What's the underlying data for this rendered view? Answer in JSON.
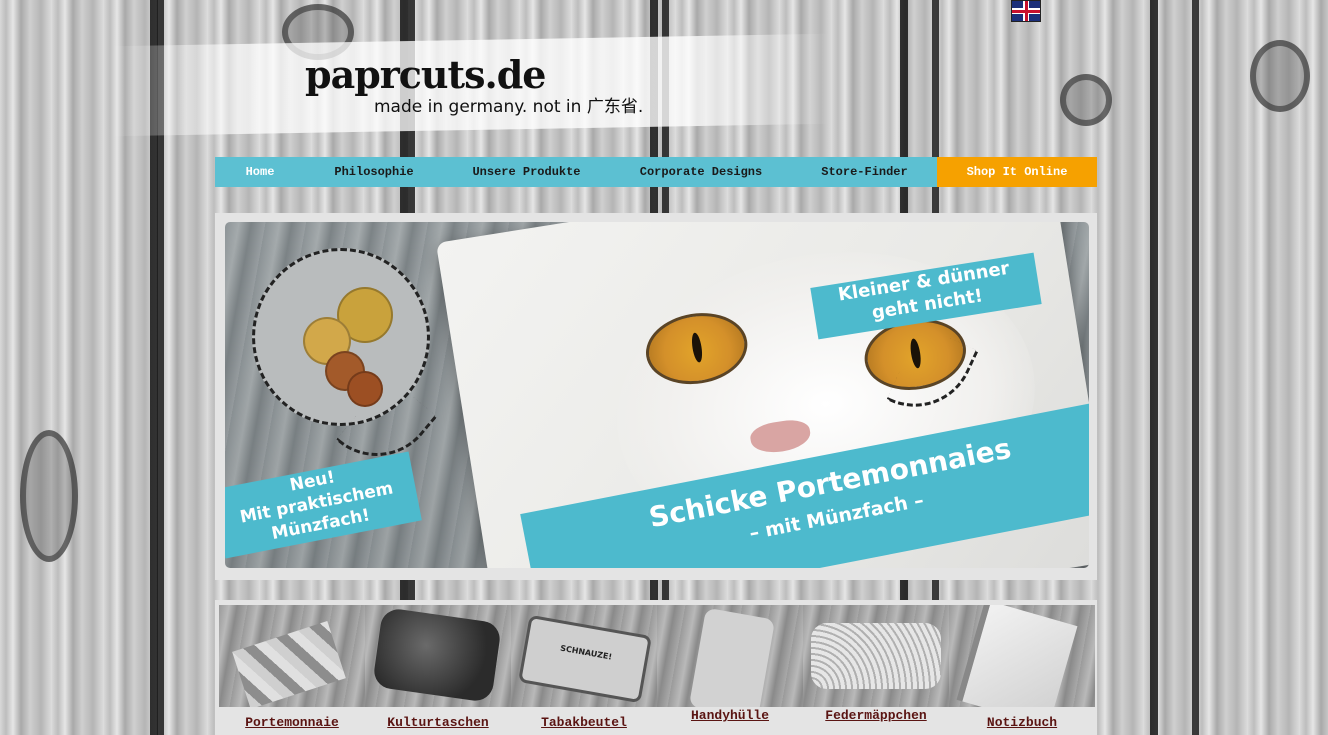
{
  "header": {
    "logo_title": "paprcuts.de",
    "tagline": "made in germany. not in 广东省.",
    "language_flag": "uk-flag-icon"
  },
  "nav": {
    "items": [
      {
        "label": "Home"
      },
      {
        "label": "Philosophie"
      },
      {
        "label": "Unsere Produkte"
      },
      {
        "label": "Corporate Designs"
      },
      {
        "label": "Store-Finder"
      },
      {
        "label": "Shop It Online"
      }
    ],
    "accent_color": "#5cc0d2",
    "shop_color": "#f6a100"
  },
  "hero": {
    "banner_neu": "Neu!\nMit praktischem\nMünzfach!",
    "banner_klein": "Kleiner & dünner\ngeht nicht!",
    "banner_main": "Schicke Portemonnaies",
    "banner_main_sub": "– mit Münzfach –",
    "accent_color": "#4dbacd"
  },
  "products": [
    {
      "label": "Portemonnaie"
    },
    {
      "label": "Kulturtaschen"
    },
    {
      "label": "Tabakbeutel",
      "print": "SCHNAUZE!"
    },
    {
      "label": "Handyhülle"
    },
    {
      "label": "Federmäppchen"
    },
    {
      "label": "Notizbuch"
    }
  ]
}
